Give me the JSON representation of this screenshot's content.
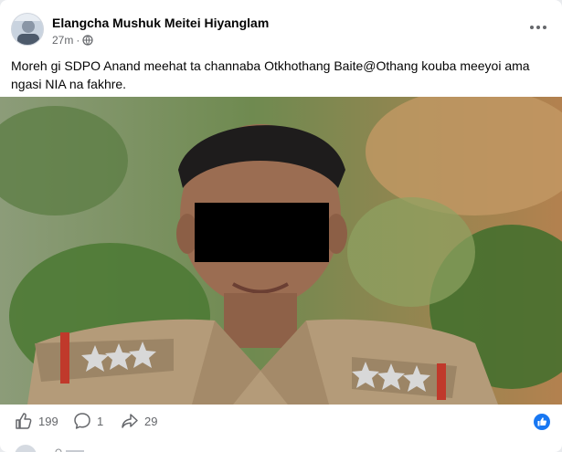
{
  "post": {
    "author": "Elangcha Mushuk Meitei Hiyanglam",
    "time": "27m",
    "separator": "·",
    "text": "Moreh gi SDPO Anand meehat ta channaba Otkhothang Baite@Othang kouba meeyoi ama ngasi NIA na fakhre."
  },
  "icons": {
    "audience": "globe-icon",
    "more": "more-options-icon",
    "like": "thumbs-up-icon",
    "comment": "comment-icon",
    "share": "share-icon",
    "reaction": "like-reaction-icon"
  },
  "stats": {
    "likes": "199",
    "comments": "1",
    "shares": "29"
  },
  "colors": {
    "accent": "#1877f2",
    "muted": "#65676b"
  }
}
